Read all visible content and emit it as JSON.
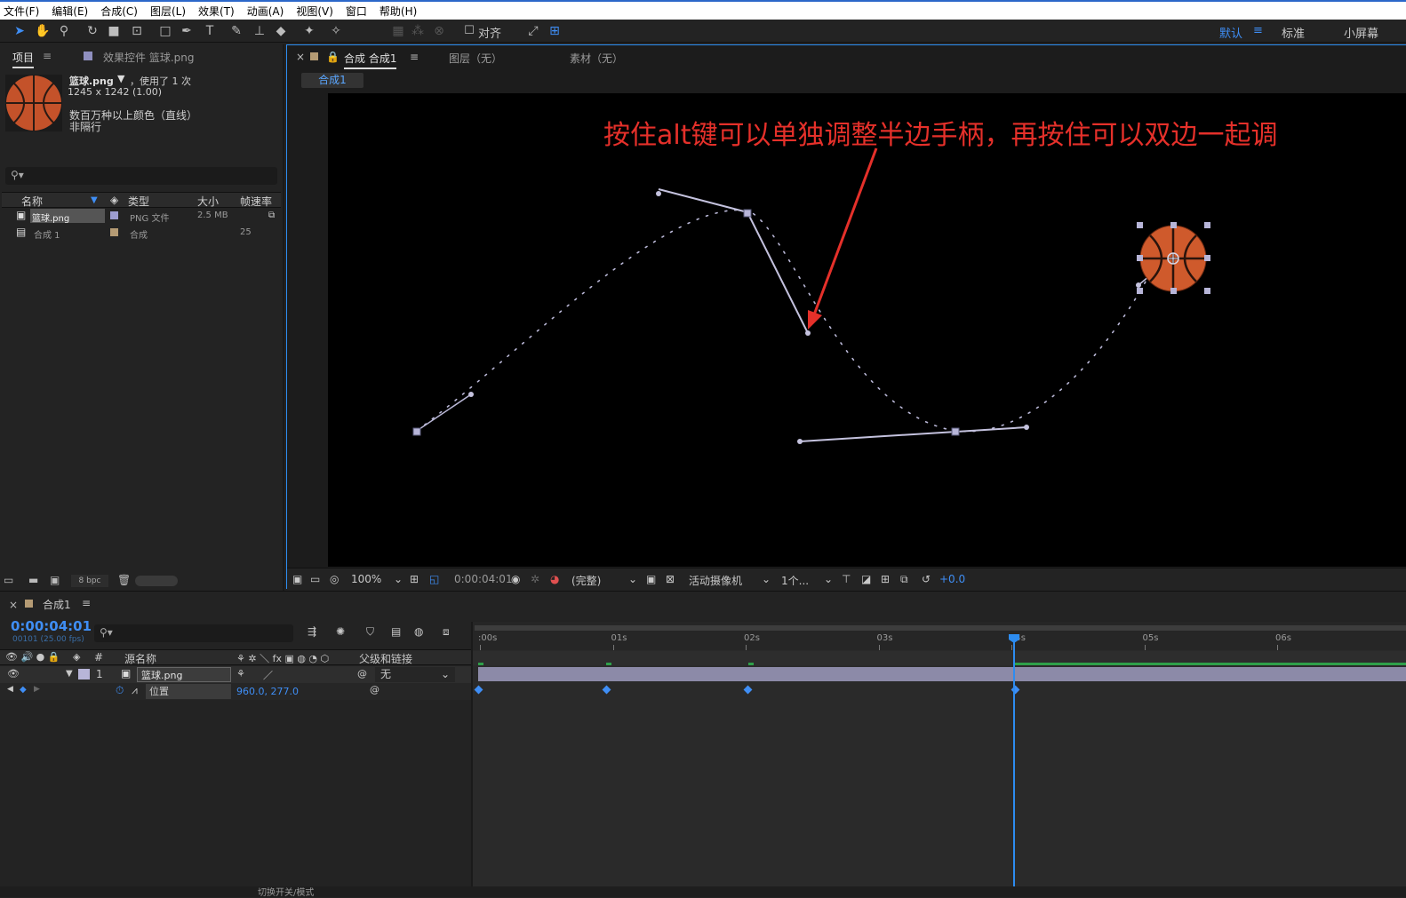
{
  "menubar": [
    "文件(F)",
    "编辑(E)",
    "合成(C)",
    "图层(L)",
    "效果(T)",
    "动画(A)",
    "视图(V)",
    "窗口",
    "帮助(H)"
  ],
  "toolbar": {
    "snap_label": "对齐",
    "workspaces": [
      "默认",
      "标准",
      "小屏幕"
    ]
  },
  "project_panel": {
    "tab_project": "项目",
    "tab_effects": "效果控件 篮球.png",
    "asset_name": "篮球.png",
    "used_times": "，使用了 1 次",
    "dimensions": "1245 x 1242 (1.00)",
    "color_info": "数百万种以上颜色（直线）",
    "color_info2": "非隔行",
    "columns": [
      "名称",
      "类型",
      "大小",
      "帧速率"
    ],
    "items": [
      {
        "name": "篮球.png",
        "type": "PNG 文件",
        "size": "2.5 MB",
        "fps": ""
      },
      {
        "name": "合成 1",
        "type": "合成",
        "size": "",
        "fps": "25"
      }
    ],
    "bpc": "8 bpc"
  },
  "comp_panel": {
    "tab_comp": "合成 合成1",
    "tab_layer": "图层（无）",
    "tab_footage": "素材（无）",
    "subtab": "合成1",
    "annotation": "按住alt键可以单独调整半边手柄，再按住可以双边一起调",
    "zoom": "100%",
    "timecode": "0:00:04:01",
    "resolution": "(完整)",
    "camera": "活动摄像机",
    "views": "1个...",
    "exposure": "+0.0"
  },
  "timeline": {
    "tab": "合成1",
    "current_time": "0:00:04:01",
    "frame_info": "00101 (25.00 fps)",
    "columns": {
      "source_name": "源名称",
      "parent": "父级和链接"
    },
    "layer": {
      "index": "1",
      "name": "篮球.png",
      "parent": "无"
    },
    "property": {
      "name": "位置",
      "value": "960.0, 277.0"
    },
    "time_ticks": [
      ":00s",
      "01s",
      "02s",
      "03s",
      "04s",
      "05s",
      "06s"
    ],
    "keyframes_sec": [
      0,
      0.96,
      2.03,
      4.04
    ],
    "bottom_label": "切换开关/模式"
  },
  "colors": {
    "accent": "#2d8cf0",
    "annotation": "#e5302a",
    "path": "#b9b7d6",
    "layer_bar": "#8c8aa8"
  }
}
